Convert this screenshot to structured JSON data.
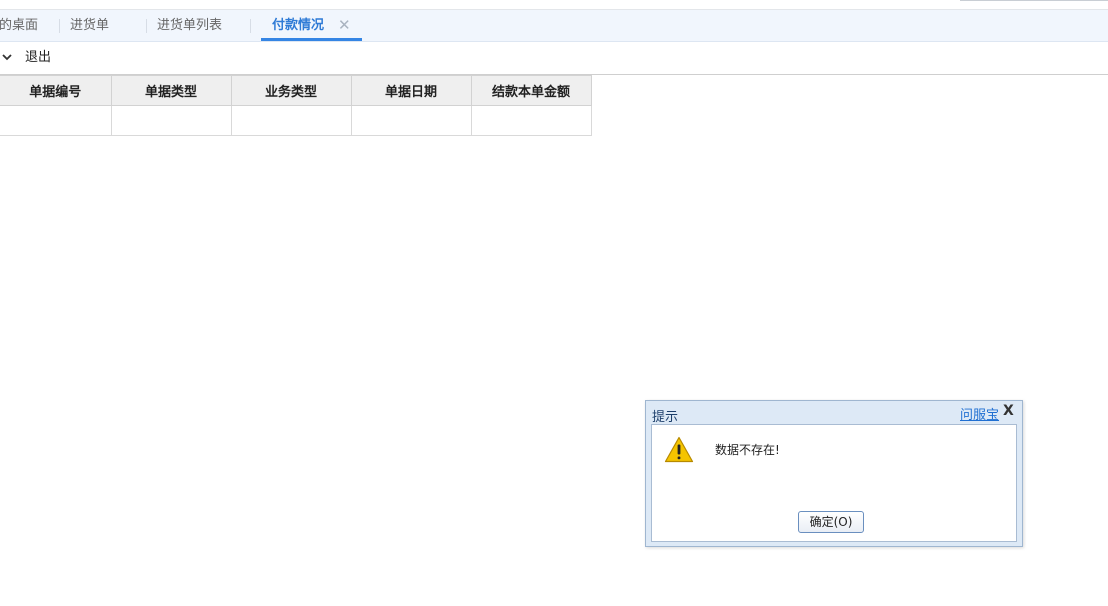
{
  "tabs": [
    {
      "label": "我的桌面"
    },
    {
      "label": "进货单"
    },
    {
      "label": "进货单列表"
    },
    {
      "label": "付款情况",
      "close": "✕",
      "active": true
    }
  ],
  "toolbar": {
    "exit_label": "退出"
  },
  "table": {
    "columns": [
      "单据编号",
      "单据类型",
      "业务类型",
      "单据日期",
      "结款本单金额"
    ],
    "rows": [
      [
        "",
        "",
        "",
        "",
        ""
      ]
    ]
  },
  "dialog": {
    "title": "提示",
    "help_link": "问服宝",
    "close": "X",
    "message": "数据不存在!",
    "ok_label": "确定(O)"
  },
  "colors": {
    "accent": "#3585e4",
    "warning": "#f5c400"
  }
}
